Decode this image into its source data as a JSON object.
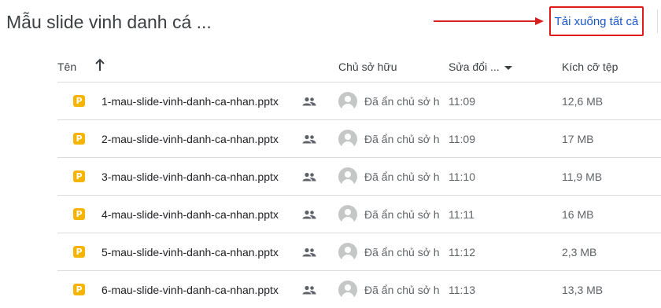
{
  "header": {
    "folder_title": "Mẫu slide vinh danh cá ...",
    "download_all_label": "Tải xuống tất cả"
  },
  "columns": {
    "name": "Tên",
    "owner": "Chủ sở hữu",
    "modified": "Sửa đổi ...",
    "size": "Kích cỡ tệp"
  },
  "icons": {
    "sort": "arrow-up-icon",
    "file": "google-slides-icon",
    "shared": "people-icon",
    "owner": "avatar-icon",
    "annotation": "red-arrow"
  },
  "colors": {
    "accent_link": "#1a56c9",
    "annotation_red": "#e01b1b",
    "slides_yellow": "#f4b400"
  },
  "files": [
    {
      "name": "1-mau-slide-vinh-danh-ca-nhan.pptx",
      "owner": "Đã ẩn chủ sở hữu",
      "modified": "11:09",
      "size": "12,6 MB"
    },
    {
      "name": "2-mau-slide-vinh-danh-ca-nhan.pptx",
      "owner": "Đã ẩn chủ sở hữu",
      "modified": "11:09",
      "size": "17 MB"
    },
    {
      "name": "3-mau-slide-vinh-danh-ca-nhan.pptx",
      "owner": "Đã ẩn chủ sở hữu",
      "modified": "11:10",
      "size": "11,9 MB"
    },
    {
      "name": "4-mau-slide-vinh-danh-ca-nhan.pptx",
      "owner": "Đã ẩn chủ sở hữu",
      "modified": "11:11",
      "size": "16 MB"
    },
    {
      "name": "5-mau-slide-vinh-danh-ca-nhan.pptx",
      "owner": "Đã ẩn chủ sở hữu",
      "modified": "11:12",
      "size": "2,3 MB"
    },
    {
      "name": "6-mau-slide-vinh-danh-ca-nhan.pptx",
      "owner": "Đã ẩn chủ sở hữu",
      "modified": "11:13",
      "size": "13,3 MB"
    }
  ]
}
